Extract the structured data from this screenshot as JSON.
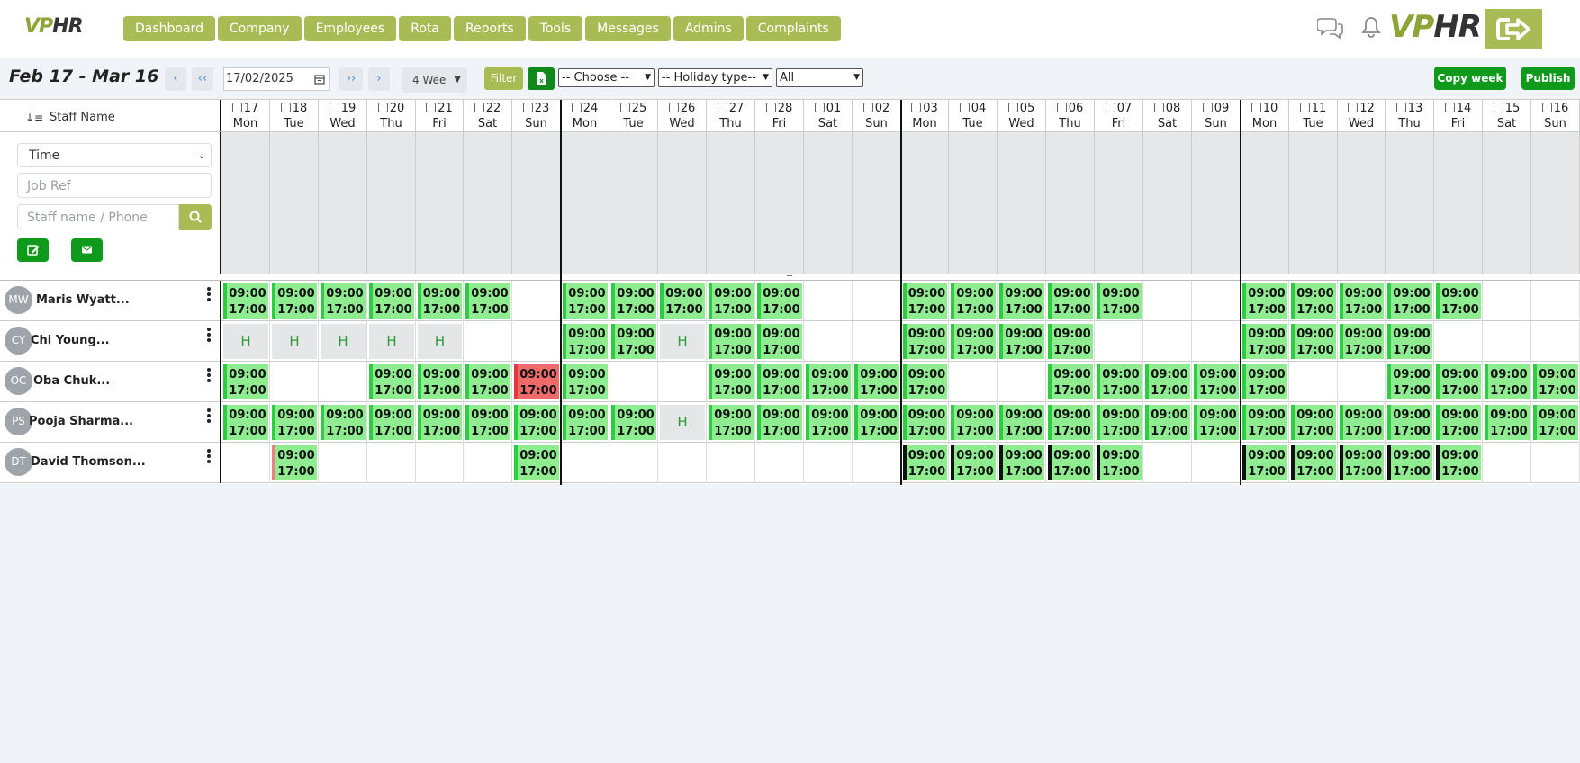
{
  "app": {
    "logo_v": "VP",
    "logo_h": "HR",
    "brand_color": "#a9bb55",
    "accent_green": "#0f9a1c"
  },
  "nav": [
    "Dashboard",
    "Company",
    "Employees",
    "Rota",
    "Reports",
    "Tools",
    "Messages",
    "Admins",
    "Complaints"
  ],
  "toolbar": {
    "range_title": "Feb 17 - Mar 16",
    "prev_label": "‹",
    "prev_week_label": "‹‹",
    "date_value": "17/02/2025",
    "next_week_label": "››",
    "next_label": "›",
    "weeks_value": "4 Wee",
    "filter_label": "Filter",
    "choose_value": "-- Choose --",
    "holiday_type_value": "-- Holiday type--",
    "all_value": "All",
    "copy_week_label": "Copy week",
    "publish_label": "Publish"
  },
  "grid": {
    "staff_header": "Staff Name",
    "sort_icon": "↓≡",
    "days": [
      {
        "num": "17",
        "name": "Mon"
      },
      {
        "num": "18",
        "name": "Tue"
      },
      {
        "num": "19",
        "name": "Wed"
      },
      {
        "num": "20",
        "name": "Thu"
      },
      {
        "num": "21",
        "name": "Fri"
      },
      {
        "num": "22",
        "name": "Sat"
      },
      {
        "num": "23",
        "name": "Sun"
      },
      {
        "num": "24",
        "name": "Mon"
      },
      {
        "num": "25",
        "name": "Tue"
      },
      {
        "num": "26",
        "name": "Wed"
      },
      {
        "num": "27",
        "name": "Thu"
      },
      {
        "num": "28",
        "name": "Fri"
      },
      {
        "num": "01",
        "name": "Sat"
      },
      {
        "num": "02",
        "name": "Sun"
      },
      {
        "num": "03",
        "name": "Mon"
      },
      {
        "num": "04",
        "name": "Tue"
      },
      {
        "num": "05",
        "name": "Wed"
      },
      {
        "num": "06",
        "name": "Thu"
      },
      {
        "num": "07",
        "name": "Fri"
      },
      {
        "num": "08",
        "name": "Sat"
      },
      {
        "num": "09",
        "name": "Sun"
      },
      {
        "num": "10",
        "name": "Mon"
      },
      {
        "num": "11",
        "name": "Tue"
      },
      {
        "num": "12",
        "name": "Wed"
      },
      {
        "num": "13",
        "name": "Thu"
      },
      {
        "num": "14",
        "name": "Fri"
      },
      {
        "num": "15",
        "name": "Sat"
      },
      {
        "num": "16",
        "name": "Sun"
      }
    ],
    "filters": {
      "time_value": "Time",
      "job_ref_placeholder": "Job Ref",
      "staff_search_placeholder": "Staff name / Phone"
    },
    "shift_start": "09:00",
    "shift_end": "17:00",
    "holiday_mark": "H",
    "staff": [
      {
        "initials": "MW",
        "name": "Maris Wyatt...",
        "cells": [
          "s",
          "s",
          "s",
          "s",
          "s",
          "s",
          "",
          "s",
          "s",
          "s",
          "s",
          "s",
          "",
          "",
          "s",
          "s",
          "s",
          "s",
          "s",
          "",
          "",
          "s",
          "s",
          "s",
          "s",
          "s",
          "",
          ""
        ]
      },
      {
        "initials": "CY",
        "name": "Chi Young...",
        "cells": [
          "h",
          "h",
          "h",
          "h",
          "h",
          "",
          "",
          "s",
          "s",
          "h",
          "s",
          "s",
          "",
          "",
          "s",
          "s",
          "s",
          "s",
          "",
          "",
          "",
          "s",
          "s",
          "s",
          "s",
          "",
          "",
          ""
        ]
      },
      {
        "initials": "OC",
        "name": "Oba Chuk...",
        "cells": [
          "s",
          "",
          "",
          "s",
          "s",
          "s",
          "r",
          "s",
          "",
          "",
          "s",
          "s",
          "s",
          "s",
          "s",
          "",
          "",
          "s",
          "s",
          "s",
          "s",
          "s",
          "",
          "",
          "s",
          "s",
          "s",
          "s"
        ]
      },
      {
        "initials": "PS",
        "name": "Pooja Sharma...",
        "cells": [
          "s",
          "s",
          "s",
          "s",
          "s",
          "s",
          "s",
          "s",
          "s",
          "h",
          "s",
          "s",
          "s",
          "s",
          "s",
          "s",
          "s",
          "s",
          "s",
          "s",
          "s",
          "s",
          "s",
          "s",
          "s",
          "s",
          "s",
          "s"
        ]
      },
      {
        "initials": "DT",
        "name": "David Thomson...",
        "cells": [
          "",
          "p",
          "",
          "",
          "",
          "",
          "s",
          "",
          "",
          "",
          "",
          "",
          "",
          "",
          "b",
          "b",
          "b",
          "b",
          "b",
          "",
          "",
          "b",
          "b",
          "b",
          "b",
          "b",
          "",
          ""
        ]
      }
    ]
  }
}
